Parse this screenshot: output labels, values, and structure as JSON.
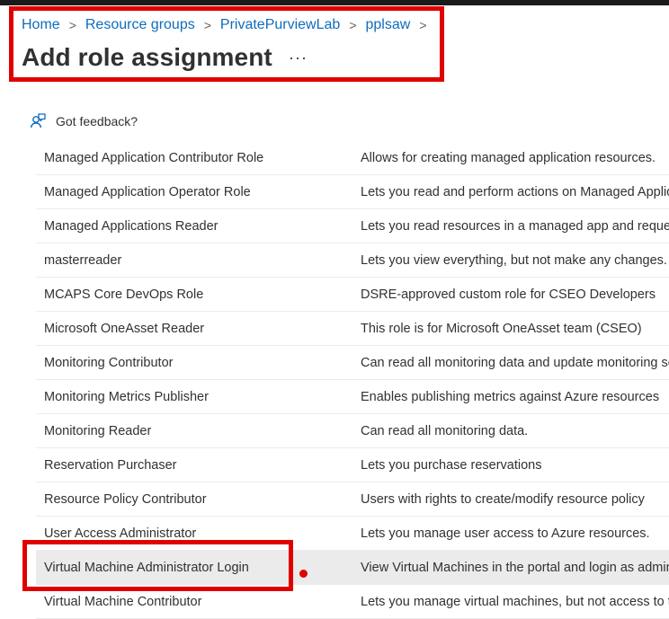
{
  "breadcrumb": [
    "Home",
    "Resource groups",
    "PrivatePurviewLab",
    "pplsaw"
  ],
  "page": {
    "title": "Add role assignment",
    "more": "···"
  },
  "feedback": {
    "label": "Got feedback?"
  },
  "roles": [
    {
      "name": "Managed Application Contributor Role",
      "description": "Allows for creating managed application resources."
    },
    {
      "name": "Managed Application Operator Role",
      "description": "Lets you read and perform actions on Managed Application resources"
    },
    {
      "name": "Managed Applications Reader",
      "description": "Lets you read resources in a managed app and request JIT access."
    },
    {
      "name": "masterreader",
      "description": "Lets you view everything, but not make any changes."
    },
    {
      "name": "MCAPS Core DevOps Role",
      "description": "DSRE-approved custom role for CSEO Developers"
    },
    {
      "name": "Microsoft OneAsset Reader",
      "description": "This role is for Microsoft OneAsset team (CSEO)"
    },
    {
      "name": "Monitoring Contributor",
      "description": "Can read all monitoring data and update monitoring settings."
    },
    {
      "name": "Monitoring Metrics Publisher",
      "description": "Enables publishing metrics against Azure resources"
    },
    {
      "name": "Monitoring Reader",
      "description": "Can read all monitoring data."
    },
    {
      "name": "Reservation Purchaser",
      "description": "Lets you purchase reservations"
    },
    {
      "name": "Resource Policy Contributor",
      "description": "Users with rights to create/modify resource policy"
    },
    {
      "name": "User Access Administrator",
      "description": "Lets you manage user access to Azure resources."
    },
    {
      "name": "Virtual Machine Administrator Login",
      "description": "View Virtual Machines in the portal and login as administrator",
      "selected": true
    },
    {
      "name": "Virtual Machine Contributor",
      "description": "Lets you manage virtual machines, but not access to them"
    }
  ],
  "colors": {
    "link": "#0f6cbd",
    "highlight": "#e00000",
    "selected_row": "#ebebeb"
  }
}
